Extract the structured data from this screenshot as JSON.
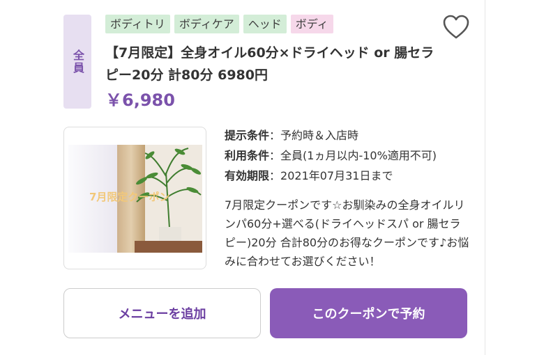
{
  "badge": {
    "label": "全員"
  },
  "tags": [
    {
      "label": "ボディトリ",
      "color": "#d3edd7"
    },
    {
      "label": "ボディケア",
      "color": "#d3edd7"
    },
    {
      "label": "ヘッド",
      "color": "#d3edd7"
    },
    {
      "label": "ボディ",
      "color": "#f6d8ea"
    }
  ],
  "coupon": {
    "title": "【7月限定】全身オイル60分×ドライヘッド or 腸セラピー20分 計80分 6980円",
    "price": "￥6,980",
    "image_caption": "7月限定クーポン",
    "conditions": [
      {
        "label": "提示条件",
        "value": "予約時＆入店時"
      },
      {
        "label": "利用条件",
        "value": "全員(1ヵ月以内-10%適用不可)"
      },
      {
        "label": "有効期限",
        "value": "2021年07月31日まで"
      }
    ],
    "description": "7月限定クーポンです☆お馴染みの全身オイルリンパ60分+選べる(ドライヘッドスパ or 腸セラピー)20分 合計80分のお得なクーポンです♪お悩みに合わせてお選びください！"
  },
  "actions": {
    "add_menu": "メニューを追加",
    "reserve": "このクーポンで予約"
  },
  "icons": {
    "favorite": "heart-outline-icon"
  },
  "colors": {
    "accent": "#7b52ab",
    "button": "#8a5bb8",
    "tag_green": "#d3edd7",
    "tag_pink": "#f6d8ea"
  }
}
